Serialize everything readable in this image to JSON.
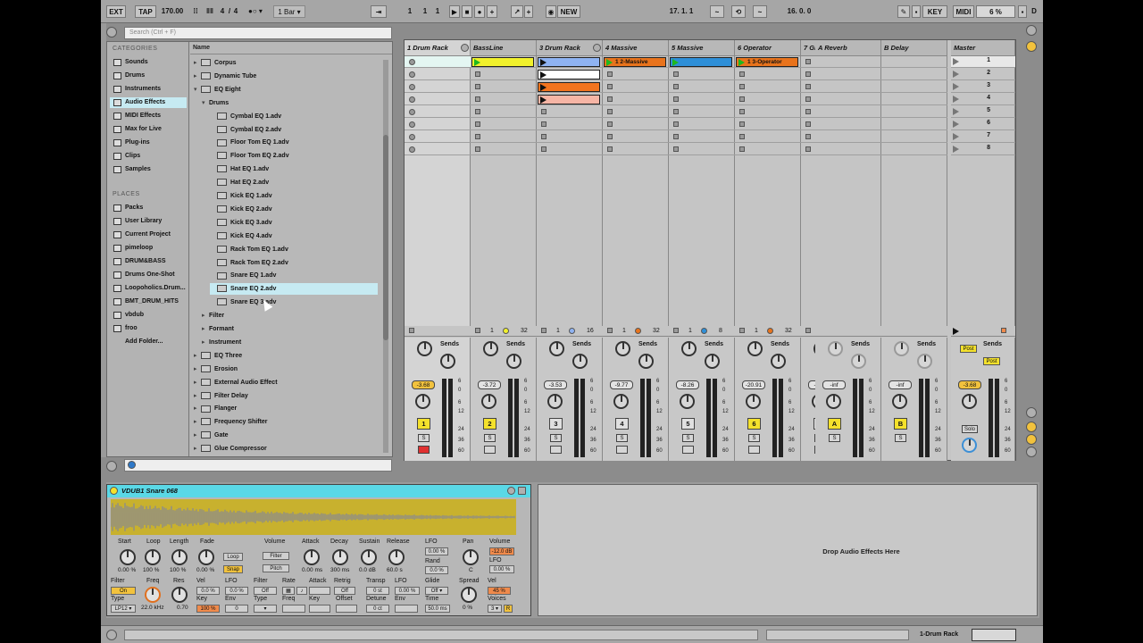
{
  "transport": {
    "ext": "EXT",
    "tap": "TAP",
    "tempo": "170.00",
    "sig_num": "4",
    "sig_den": "4",
    "quant": "1 Bar",
    "pos1": "1",
    "pos2": "1",
    "pos3": "1",
    "new": "NEW",
    "loop_start": "17.  1.  1",
    "loop_len": "16.  0.  0",
    "key": "KEY",
    "midi": "MIDI",
    "cpu": "6 %",
    "d": "D"
  },
  "search": {
    "placeholder": "Search (Ctrl + F)"
  },
  "categories": {
    "header": "CATEGORIES",
    "items": [
      "Sounds",
      "Drums",
      "Instruments",
      "Audio Effects",
      "MIDI Effects",
      "Max for Live",
      "Plug-ins",
      "Clips",
      "Samples"
    ],
    "selected": 3
  },
  "places": {
    "header": "PLACES",
    "items": [
      "Packs",
      "User Library",
      "Current Project",
      "pimeloop",
      "DRUM&BASS",
      "Drums One-Shot",
      "Loopoholics.Drum...",
      "BMT_DRUM_HITS",
      "vbdub",
      "froo",
      "Add Folder..."
    ]
  },
  "files": {
    "column": "Name",
    "items": [
      {
        "label": "Corpus",
        "level": 0,
        "arrow": "▸",
        "icon": true
      },
      {
        "label": "Dynamic Tube",
        "level": 0,
        "arrow": "▸",
        "icon": true
      },
      {
        "label": "EQ Eight",
        "level": 0,
        "arrow": "▾",
        "icon": true
      },
      {
        "label": "Drums",
        "level": 1,
        "arrow": "▾",
        "icon": false
      },
      {
        "label": "Cymbal EQ 1.adv",
        "level": 2,
        "arrow": "",
        "icon": true
      },
      {
        "label": "Cymbal EQ 2.adv",
        "level": 2,
        "arrow": "",
        "icon": true
      },
      {
        "label": "Floor Tom EQ 1.adv",
        "level": 2,
        "arrow": "",
        "icon": true
      },
      {
        "label": "Floor Tom EQ 2.adv",
        "level": 2,
        "arrow": "",
        "icon": true
      },
      {
        "label": "Hat EQ 1.adv",
        "level": 2,
        "arrow": "",
        "icon": true
      },
      {
        "label": "Hat EQ 2.adv",
        "level": 2,
        "arrow": "",
        "icon": true
      },
      {
        "label": "Kick EQ 1.adv",
        "level": 2,
        "arrow": "",
        "icon": true
      },
      {
        "label": "Kick EQ 2.adv",
        "level": 2,
        "arrow": "",
        "icon": true
      },
      {
        "label": "Kick EQ 3.adv",
        "level": 2,
        "arrow": "",
        "icon": true
      },
      {
        "label": "Kick EQ 4.adv",
        "level": 2,
        "arrow": "",
        "icon": true
      },
      {
        "label": "Rack Tom EQ 1.adv",
        "level": 2,
        "arrow": "",
        "icon": true
      },
      {
        "label": "Rack Tom EQ 2.adv",
        "level": 2,
        "arrow": "",
        "icon": true
      },
      {
        "label": "Snare EQ 1.adv",
        "level": 2,
        "arrow": "",
        "icon": true
      },
      {
        "label": "Snare EQ 2.adv",
        "level": 2,
        "arrow": "",
        "icon": true,
        "selected": true
      },
      {
        "label": "Snare EQ 3.adv",
        "level": 2,
        "arrow": "",
        "icon": true
      },
      {
        "label": "Filter",
        "level": 1,
        "arrow": "▸",
        "icon": false
      },
      {
        "label": "Formant",
        "level": 1,
        "arrow": "▸",
        "icon": false
      },
      {
        "label": "Instrument",
        "level": 1,
        "arrow": "▸",
        "icon": false
      },
      {
        "label": "EQ Three",
        "level": 0,
        "arrow": "▸",
        "icon": true
      },
      {
        "label": "Erosion",
        "level": 0,
        "arrow": "▸",
        "icon": true
      },
      {
        "label": "External Audio Effect",
        "level": 0,
        "arrow": "▸",
        "icon": true
      },
      {
        "label": "Filter Delay",
        "level": 0,
        "arrow": "▸",
        "icon": true
      },
      {
        "label": "Flanger",
        "level": 0,
        "arrow": "▸",
        "icon": true
      },
      {
        "label": "Frequency Shifter",
        "level": 0,
        "arrow": "▸",
        "icon": true
      },
      {
        "label": "Gate",
        "level": 0,
        "arrow": "▸",
        "icon": true
      },
      {
        "label": "Glue Compressor",
        "level": 0,
        "arrow": "▸",
        "icon": true
      }
    ]
  },
  "tracks": [
    {
      "name": "1 Drum Rack",
      "selected": true,
      "num": "1",
      "vol": "-3.68",
      "numColor": "y",
      "volColor": "y",
      "armRed": true,
      "clips": [
        null,
        null,
        null,
        null,
        null,
        null,
        null,
        null
      ],
      "inA": "",
      "inB": "",
      "dotColor": ""
    },
    {
      "name": "BassLine",
      "num": "2",
      "vol": "-3.72",
      "numColor": "y",
      "clips": [
        {
          "label": "",
          "color": "#f1f12c",
          "green": true
        },
        null,
        null,
        null,
        null,
        null,
        null,
        null
      ],
      "inA": "1",
      "inB": "32",
      "dotColor": "#f1f12c"
    },
    {
      "name": "3 Drum Rack",
      "num": "3",
      "vol": "-3.53",
      "clips": [
        {
          "label": "",
          "color": "#8fb3f2"
        },
        {
          "label": "",
          "color": "#ffffff"
        },
        {
          "label": "",
          "color": "#f2741f"
        },
        {
          "label": "",
          "color": "#f6b5a5"
        },
        null,
        null,
        null,
        null
      ],
      "inA": "1",
      "inB": "16",
      "dotColor": "#8fb3f2"
    },
    {
      "name": "4 Massive",
      "num": "4",
      "vol": "-9.77",
      "clips": [
        {
          "label": "1 2-Massive",
          "color": "#e8731c",
          "green": true
        },
        null,
        null,
        null,
        null,
        null,
        null,
        null
      ],
      "inA": "1",
      "inB": "32",
      "dotColor": "#e8731c"
    },
    {
      "name": "5 Massive",
      "num": "5",
      "vol": "-8.26",
      "clips": [
        {
          "label": "",
          "color": "#2e8fd8",
          "green": true
        },
        null,
        null,
        null,
        null,
        null,
        null,
        null
      ],
      "inA": "1",
      "inB": "8",
      "dotColor": "#2e8fd8"
    },
    {
      "name": "6 Operator",
      "num": "6",
      "vol": "-20.91",
      "numColor": "y",
      "clips": [
        {
          "label": "1 3-Operator",
          "color": "#e8731c",
          "green": true
        },
        null,
        null,
        null,
        null,
        null,
        null,
        null
      ],
      "inA": "1",
      "inB": "32",
      "dotColor": "#e8731c"
    },
    {
      "name": "7 Glue",
      "num": "7",
      "vol": "-inf",
      "clips": [
        null,
        null,
        null,
        null,
        null,
        null,
        null,
        null
      ],
      "inA": "",
      "inB": "",
      "dotColor": ""
    }
  ],
  "returns": [
    {
      "name": "A Reverb",
      "num": "A",
      "vol": "-inf"
    },
    {
      "name": "B Delay",
      "num": "B",
      "vol": "-inf"
    }
  ],
  "master": {
    "name": "Master",
    "vol": "-3.68",
    "scenes": [
      "1",
      "2",
      "3",
      "4",
      "5",
      "6",
      "7",
      "8"
    ],
    "post1": "Post",
    "post2": "Post",
    "solo": "Solo"
  },
  "mixer": {
    "sends": "Sends",
    "s": "S",
    "scale": [
      "6",
      "0",
      "6",
      "12",
      "24",
      "36",
      "60"
    ]
  },
  "simpler": {
    "title": "VDUB1 Snare 068",
    "row1": {
      "labels": [
        "Start",
        "Loop",
        "Length",
        "Fade",
        "Volume",
        "Attack",
        "Decay",
        "Sustain",
        "Release",
        "LFO",
        "Pan",
        "Volume"
      ],
      "values": [
        "0.00 %",
        "100 %",
        "100 %",
        "0.00 %",
        "0.00 ms",
        "300 ms",
        "0.0 dB",
        "60.0 s"
      ],
      "loop": "Loop",
      "snap": "Snap",
      "filter": "Filter",
      "pitch": "Pitch",
      "lfo_val": "0.00 %",
      "rand": "Rand",
      "rand_val": "0.0 %",
      "pan_val": "C",
      "vol_val": "-12.0 dB",
      "lfo2": "LFO",
      "lfo2_val": "0.00 %"
    },
    "row2": {
      "labels": [
        "Filter",
        "Freq",
        "Res",
        "Vel",
        "LFO",
        "Filter",
        "Rate",
        "Retrig",
        "Transp",
        "LFO",
        "Glide",
        "Vel"
      ],
      "on": "On",
      "vel_val": "0.0 %",
      "lfo_val": "0.0 %",
      "off1": "Off",
      "attack": "Attack",
      "off2": "Off",
      "transp_val": "0 st",
      "lfo2_val": "0.00 %",
      "glide_val": "Off",
      "vel2_val": "45 %",
      "freq_val": "22.0 kHz",
      "res_val": "0.70",
      "type": "Type",
      "type_val": "LP12",
      "key": "Key",
      "key_val": "100 %",
      "env": "Env",
      "env_val": "0",
      "type2": "Type",
      "freq2": "Freq",
      "key2": "Key",
      "offset": "Offset",
      "detune": "Detune",
      "env2": "Env",
      "time": "Time",
      "time_val": "50.0 ms",
      "spread": "Spread",
      "spread_val": "0 %",
      "voices": "Voices",
      "voices_val": "3",
      "detune_val": "0 ct",
      "r": "R"
    }
  },
  "dropzone": {
    "text": "Drop Audio Effects Here"
  },
  "statusbar": {
    "selected": "1-Drum Rack"
  }
}
